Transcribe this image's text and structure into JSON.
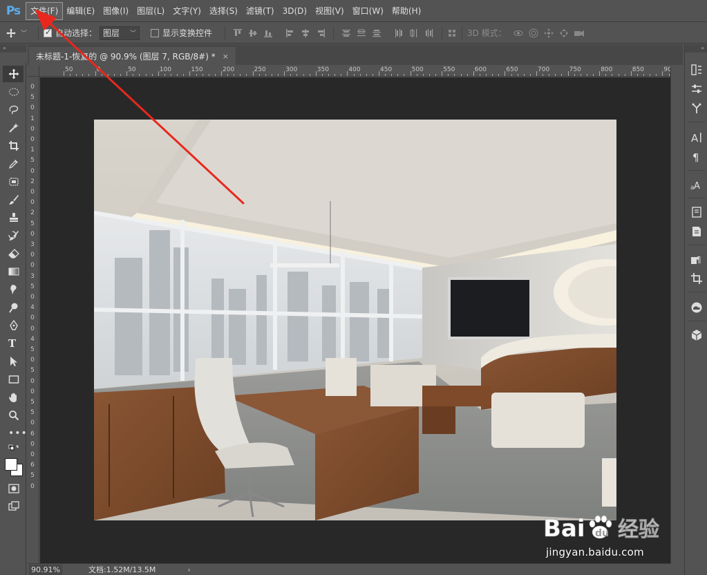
{
  "app": {
    "logo": "Ps"
  },
  "menu": [
    {
      "label": "文件(F)",
      "active": true
    },
    {
      "label": "编辑(E)"
    },
    {
      "label": "图像(I)"
    },
    {
      "label": "图层(L)"
    },
    {
      "label": "文字(Y)"
    },
    {
      "label": "选择(S)"
    },
    {
      "label": "滤镜(T)"
    },
    {
      "label": "3D(D)"
    },
    {
      "label": "视图(V)"
    },
    {
      "label": "窗口(W)"
    },
    {
      "label": "帮助(H)"
    }
  ],
  "options": {
    "auto_select_label": "自动选择：",
    "auto_select_checked": true,
    "auto_select_target": "图层",
    "show_transform_label": "显示变换控件",
    "show_transform_checked": false,
    "mode_3d_label": "3D 模式："
  },
  "document": {
    "tab_title": "未标题-1-恢复的 @ 90.9% (图层 7, RGB/8#) *",
    "close_glyph": "×"
  },
  "ruler": {
    "h_labels": [
      "50",
      "0",
      "50",
      "100",
      "150",
      "200",
      "250",
      "300",
      "350",
      "400",
      "450",
      "500",
      "550",
      "600",
      "650",
      "700",
      "750",
      "800",
      "850",
      "90"
    ],
    "v_labels": [
      "0",
      "5",
      "0",
      "1",
      "0",
      "0",
      "1",
      "5",
      "0",
      "2",
      "0",
      "0",
      "2",
      "5",
      "0",
      "3",
      "0",
      "0",
      "3",
      "5",
      "0",
      "4",
      "0",
      "0",
      "4",
      "5",
      "0",
      "5",
      "0",
      "0",
      "5",
      "5",
      "0",
      "6",
      "0",
      "0",
      "6",
      "5",
      "0"
    ]
  },
  "status": {
    "zoom": "90.91%",
    "doc_info": "文档:1.52M/13.5M",
    "arrow": "›"
  },
  "watermark": {
    "brand": "Bai",
    "brand_tail": "经验",
    "url": "jingyan.baidu.com"
  },
  "colors": {
    "ps_blue": "#5aaef0",
    "arrow_red": "#e8281e",
    "ui_gray": "#535353"
  }
}
